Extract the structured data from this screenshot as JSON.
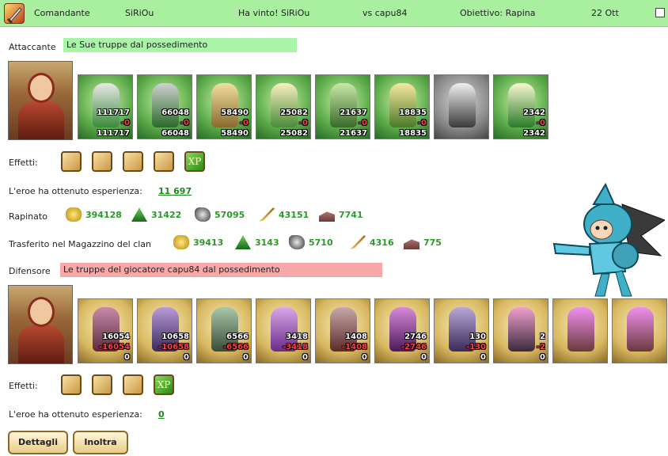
{
  "header": {
    "commander_label": "Comandante",
    "player": "SiRiOu",
    "result": "Ha vinto! SiRiOu",
    "versus": "vs capu84",
    "objective": "Obiettivo: Rapina",
    "date": "22 Ott"
  },
  "attacker": {
    "label": "Attaccante",
    "bar_text": "Le Sue truppe dal possedimento",
    "units": [
      {
        "icon": "green-knight-unit-icon",
        "count": "111717",
        "loss": "-0",
        "remaining": "111717"
      },
      {
        "icon": "green-swordsman-unit-icon",
        "count": "66048",
        "loss": "-0",
        "remaining": "66048"
      },
      {
        "icon": "spearman-unit-icon",
        "count": "58490",
        "loss": "-0",
        "remaining": "58490"
      },
      {
        "icon": "winged-warrior-unit-icon",
        "count": "25082",
        "loss": "-0",
        "remaining": "25082"
      },
      {
        "icon": "archer-unit-icon",
        "count": "21637",
        "loss": "-0",
        "remaining": "21637"
      },
      {
        "icon": "elf-mage-unit-icon",
        "count": "18835",
        "loss": "-0",
        "remaining": "18835"
      },
      {
        "icon": "grey-monk-unit-icon",
        "count": "",
        "loss": "",
        "remaining": ""
      },
      {
        "icon": "druid-unit-icon",
        "count": "2342",
        "loss": "-0",
        "remaining": "2342"
      }
    ],
    "effects_label": "Effetti:",
    "effects": [
      "crossbow-effect-icon",
      "horn-effect-icon",
      "scroll-effect-icon",
      "shield-effect-icon",
      "xp-effect-icon"
    ],
    "xp_badge": "XP",
    "xp_text": "L'eroe ha ottenuto esperienza:",
    "xp_value": "11 697",
    "plunder_label": "Rapinato",
    "plunder": [
      {
        "icon": "gold-coins-icon",
        "value": "394128"
      },
      {
        "icon": "wood-tree-icon",
        "value": "31422"
      },
      {
        "icon": "ore-rocks-icon",
        "value": "57095"
      },
      {
        "icon": "grain-wheat-icon",
        "value": "43151"
      },
      {
        "icon": "stone-bricks-icon",
        "value": "7741"
      }
    ],
    "clan_label": "Trasferito nel Magazzino del clan",
    "clan": [
      {
        "icon": "gold-coins-icon",
        "value": "39413"
      },
      {
        "icon": "wood-tree-icon",
        "value": "3143"
      },
      {
        "icon": "ore-rocks-icon",
        "value": "5710"
      },
      {
        "icon": "grain-wheat-icon",
        "value": "4316"
      },
      {
        "icon": "stone-bricks-icon",
        "value": "775"
      }
    ]
  },
  "defender": {
    "label": "Difensore",
    "bar_text": "Le truppe del giocatore capu84 dal possedimento",
    "units": [
      {
        "icon": "beast-rider-unit-icon",
        "count": "16054",
        "loss": "-16054",
        "remaining": "0"
      },
      {
        "icon": "purple-assassin-unit-icon",
        "count": "10658",
        "loss": "-10658",
        "remaining": "0"
      },
      {
        "icon": "lizard-warrior-unit-icon",
        "count": "6566",
        "loss": "-6566",
        "remaining": "0"
      },
      {
        "icon": "winged-demon-unit-icon",
        "count": "3418",
        "loss": "-3418",
        "remaining": "0"
      },
      {
        "icon": "dark-archer-unit-icon",
        "count": "1408",
        "loss": "-1408",
        "remaining": "0"
      },
      {
        "icon": "warlock-unit-icon",
        "count": "2746",
        "loss": "-2746",
        "remaining": "0"
      },
      {
        "icon": "dark-rogue-unit-icon",
        "count": "130",
        "loss": "-130",
        "remaining": "0"
      },
      {
        "icon": "spider-queen-unit-icon",
        "count": "2",
        "loss": "-2",
        "remaining": "0"
      },
      {
        "icon": "magic-orb-tower-icon",
        "count": "",
        "loss": "",
        "remaining": ""
      },
      {
        "icon": "magic-orb-tower-icon",
        "count": "",
        "loss": "",
        "remaining": ""
      }
    ],
    "effects_label": "Effetti:",
    "effects": [
      "armor-effect-icon",
      "ring-effect-icon",
      "potion-effect-icon",
      "xp-effect-icon"
    ],
    "xp_badge": "XP",
    "xp_text": "L'eroe ha ottenuto esperienza:",
    "xp_value": "0"
  },
  "buttons": {
    "details": "Dettagli",
    "forward": "Inoltra"
  },
  "colors": {
    "header": "#a8f0a0",
    "attacker_bar": "#a8f5a8",
    "defender_bar": "#f7a9a9",
    "value_green": "#2a9a2a"
  }
}
